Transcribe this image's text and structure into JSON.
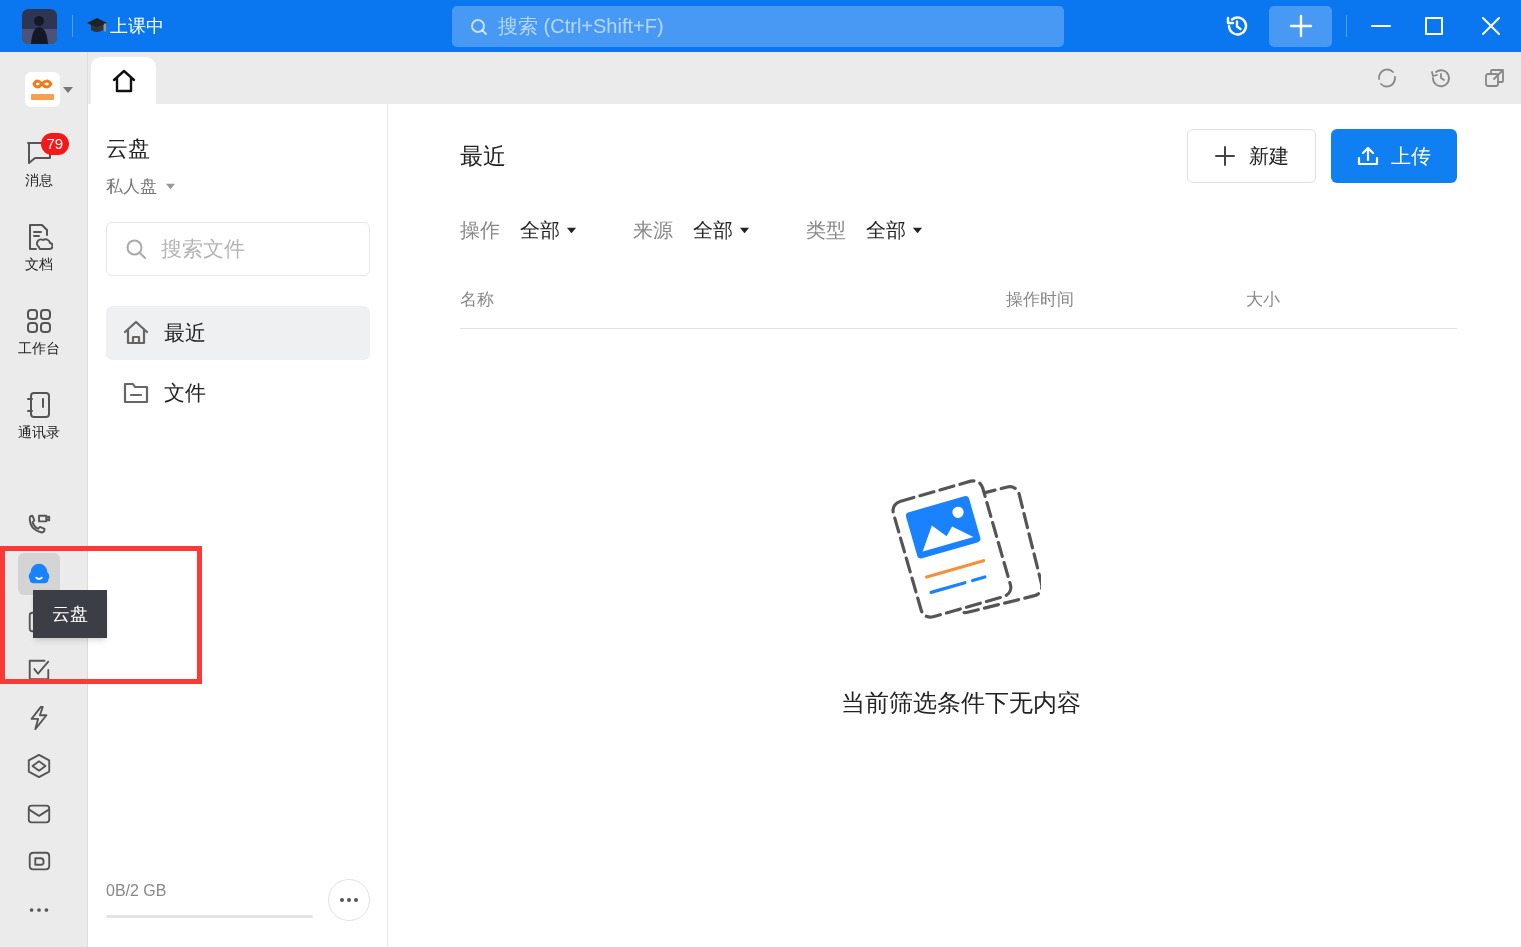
{
  "title_bar": {
    "status": "上课中",
    "search": {
      "placeholder": "搜索 (Ctrl+Shift+F)"
    }
  },
  "rail": {
    "items": [
      {
        "label": "消息",
        "badge": "79",
        "selected": false
      },
      {
        "label": "文档",
        "selected": false
      },
      {
        "label": "工作台",
        "selected": false
      },
      {
        "label": "通讯录",
        "selected": false
      },
      {
        "selected": false
      },
      {
        "selected": true
      },
      {
        "selected": false
      },
      {
        "selected": false
      },
      {
        "selected": false
      },
      {
        "selected": false
      },
      {
        "selected": false
      },
      {
        "selected": false
      },
      {
        "selected": false
      }
    ],
    "tooltip": "云盘"
  },
  "panel": {
    "title": "云盘",
    "drive": "私人盘",
    "search": {
      "placeholder": "搜索文件"
    },
    "nav": [
      {
        "label": "最近",
        "selected": true
      },
      {
        "label": "文件",
        "selected": false
      }
    ],
    "storage": {
      "reading": "0B/2 GB",
      "level": 0
    }
  },
  "main": {
    "heading": "最近",
    "buttons": [
      {
        "label": "新建",
        "kind": "secondary"
      },
      {
        "label": "上传",
        "kind": "primary"
      }
    ],
    "filters": [
      {
        "label": "操作",
        "value": "全部"
      },
      {
        "label": "来源",
        "value": "全部"
      },
      {
        "label": "类型",
        "value": "全部"
      }
    ],
    "columns": [
      "名称",
      "操作时间",
      "大小"
    ],
    "empty_text": "当前筛选条件下无内容"
  }
}
